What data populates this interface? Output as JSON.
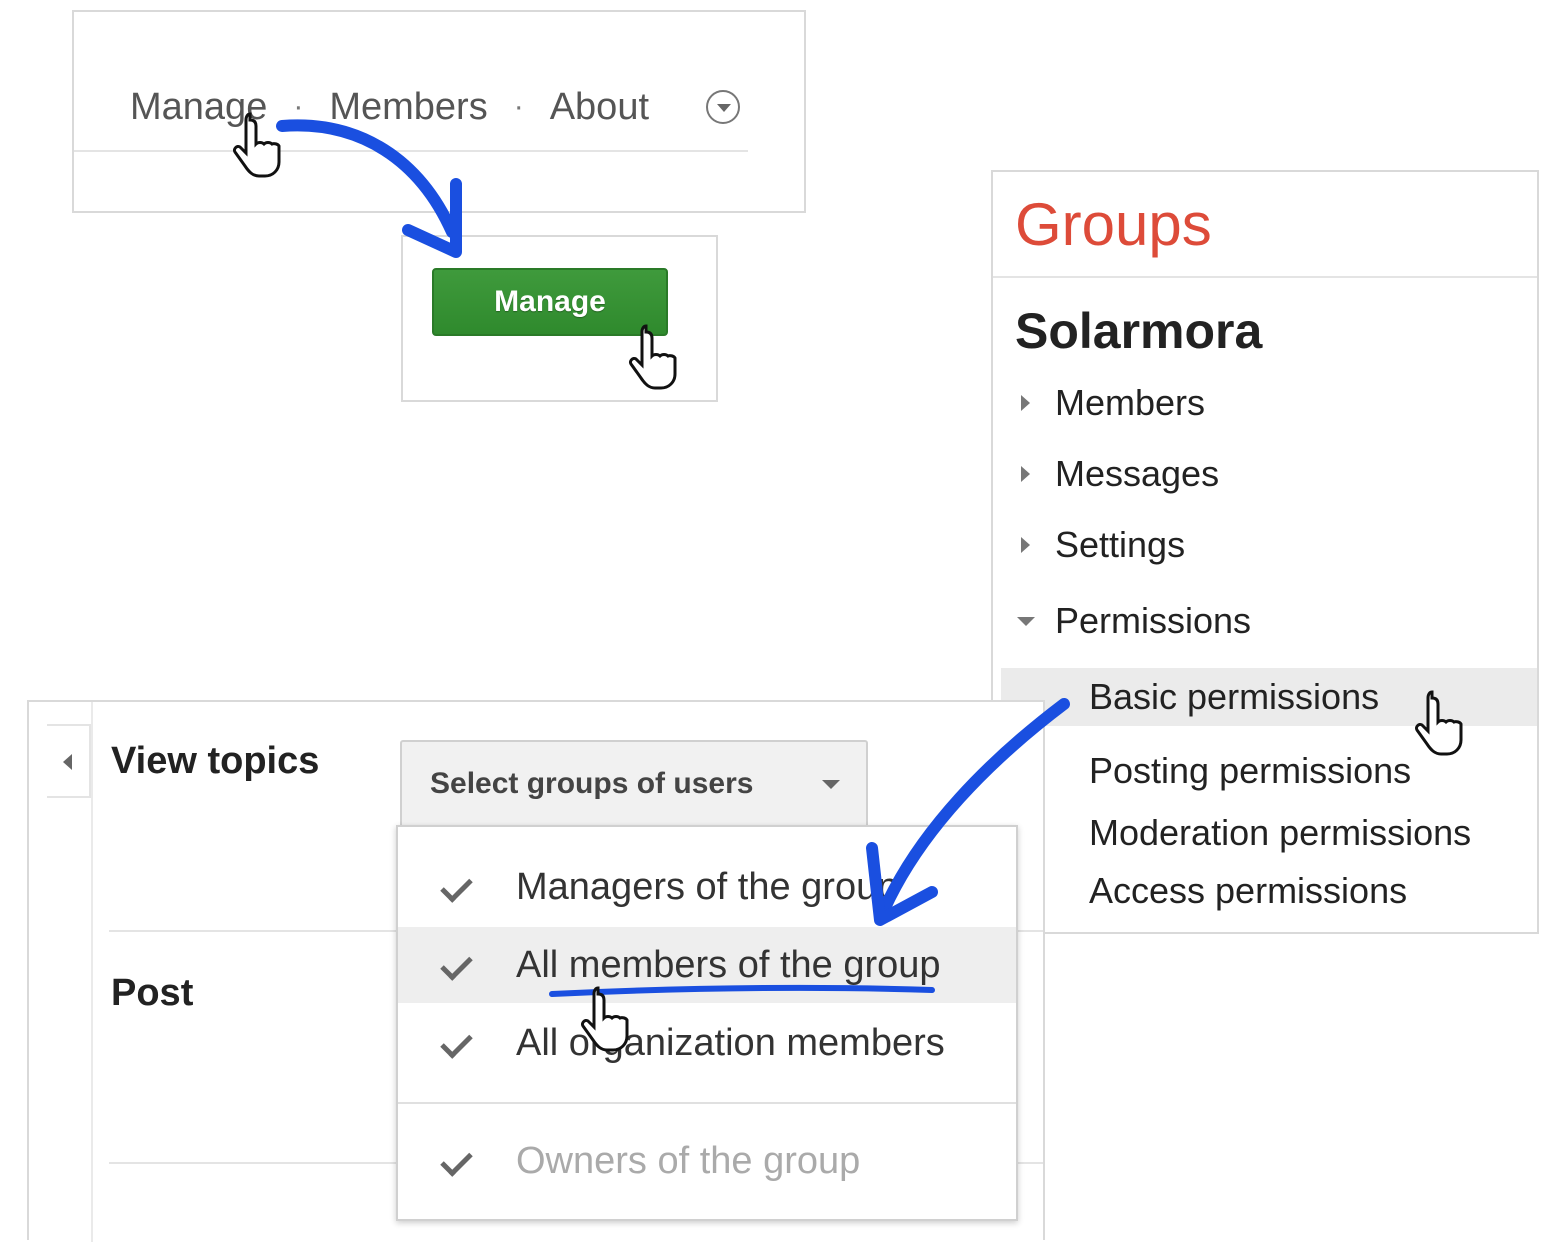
{
  "nav": {
    "items": [
      "Manage",
      "Members",
      "About"
    ],
    "separator": "·"
  },
  "manage_button": {
    "label": "Manage",
    "color": "#3a943a"
  },
  "sidebar": {
    "title": "Groups",
    "title_color": "#dd4b39",
    "group_name": "Solarmora",
    "items": [
      {
        "label": "Members",
        "state": "collapsed"
      },
      {
        "label": "Messages",
        "state": "collapsed"
      },
      {
        "label": "Settings",
        "state": "collapsed"
      },
      {
        "label": "Permissions",
        "state": "expanded"
      }
    ],
    "sub_items": [
      "Basic permissions",
      "Posting permissions",
      "Moderation permissions",
      "Access permissions"
    ],
    "highlighted_sub_item": "Basic permissions"
  },
  "permissions": {
    "rows": [
      "View topics",
      "Post"
    ],
    "select_label": "Select groups of users",
    "options": [
      {
        "label": "Managers of the group",
        "checked": true,
        "disabled": false
      },
      {
        "label": "All members of the group",
        "checked": true,
        "disabled": false,
        "hovered": true
      },
      {
        "label": "All organization members",
        "checked": true,
        "disabled": false
      },
      {
        "label": "Owners of the group",
        "checked": true,
        "disabled": true
      }
    ]
  },
  "annotation_color": "#1a4fe0"
}
